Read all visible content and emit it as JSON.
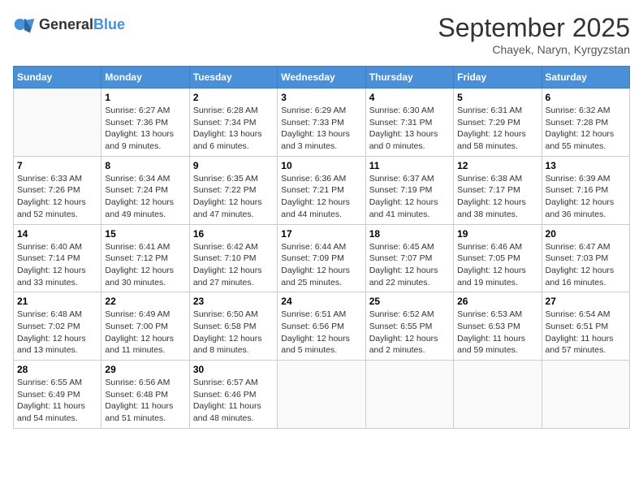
{
  "header": {
    "logo_general": "General",
    "logo_blue": "Blue",
    "month_title": "September 2025",
    "location": "Chayek, Naryn, Kyrgyzstan"
  },
  "days_of_week": [
    "Sunday",
    "Monday",
    "Tuesday",
    "Wednesday",
    "Thursday",
    "Friday",
    "Saturday"
  ],
  "weeks": [
    [
      {
        "day": "",
        "info": ""
      },
      {
        "day": "1",
        "info": "Sunrise: 6:27 AM\nSunset: 7:36 PM\nDaylight: 13 hours\nand 9 minutes."
      },
      {
        "day": "2",
        "info": "Sunrise: 6:28 AM\nSunset: 7:34 PM\nDaylight: 13 hours\nand 6 minutes."
      },
      {
        "day": "3",
        "info": "Sunrise: 6:29 AM\nSunset: 7:33 PM\nDaylight: 13 hours\nand 3 minutes."
      },
      {
        "day": "4",
        "info": "Sunrise: 6:30 AM\nSunset: 7:31 PM\nDaylight: 13 hours\nand 0 minutes."
      },
      {
        "day": "5",
        "info": "Sunrise: 6:31 AM\nSunset: 7:29 PM\nDaylight: 12 hours\nand 58 minutes."
      },
      {
        "day": "6",
        "info": "Sunrise: 6:32 AM\nSunset: 7:28 PM\nDaylight: 12 hours\nand 55 minutes."
      }
    ],
    [
      {
        "day": "7",
        "info": "Sunrise: 6:33 AM\nSunset: 7:26 PM\nDaylight: 12 hours\nand 52 minutes."
      },
      {
        "day": "8",
        "info": "Sunrise: 6:34 AM\nSunset: 7:24 PM\nDaylight: 12 hours\nand 49 minutes."
      },
      {
        "day": "9",
        "info": "Sunrise: 6:35 AM\nSunset: 7:22 PM\nDaylight: 12 hours\nand 47 minutes."
      },
      {
        "day": "10",
        "info": "Sunrise: 6:36 AM\nSunset: 7:21 PM\nDaylight: 12 hours\nand 44 minutes."
      },
      {
        "day": "11",
        "info": "Sunrise: 6:37 AM\nSunset: 7:19 PM\nDaylight: 12 hours\nand 41 minutes."
      },
      {
        "day": "12",
        "info": "Sunrise: 6:38 AM\nSunset: 7:17 PM\nDaylight: 12 hours\nand 38 minutes."
      },
      {
        "day": "13",
        "info": "Sunrise: 6:39 AM\nSunset: 7:16 PM\nDaylight: 12 hours\nand 36 minutes."
      }
    ],
    [
      {
        "day": "14",
        "info": "Sunrise: 6:40 AM\nSunset: 7:14 PM\nDaylight: 12 hours\nand 33 minutes."
      },
      {
        "day": "15",
        "info": "Sunrise: 6:41 AM\nSunset: 7:12 PM\nDaylight: 12 hours\nand 30 minutes."
      },
      {
        "day": "16",
        "info": "Sunrise: 6:42 AM\nSunset: 7:10 PM\nDaylight: 12 hours\nand 27 minutes."
      },
      {
        "day": "17",
        "info": "Sunrise: 6:44 AM\nSunset: 7:09 PM\nDaylight: 12 hours\nand 25 minutes."
      },
      {
        "day": "18",
        "info": "Sunrise: 6:45 AM\nSunset: 7:07 PM\nDaylight: 12 hours\nand 22 minutes."
      },
      {
        "day": "19",
        "info": "Sunrise: 6:46 AM\nSunset: 7:05 PM\nDaylight: 12 hours\nand 19 minutes."
      },
      {
        "day": "20",
        "info": "Sunrise: 6:47 AM\nSunset: 7:03 PM\nDaylight: 12 hours\nand 16 minutes."
      }
    ],
    [
      {
        "day": "21",
        "info": "Sunrise: 6:48 AM\nSunset: 7:02 PM\nDaylight: 12 hours\nand 13 minutes."
      },
      {
        "day": "22",
        "info": "Sunrise: 6:49 AM\nSunset: 7:00 PM\nDaylight: 12 hours\nand 11 minutes."
      },
      {
        "day": "23",
        "info": "Sunrise: 6:50 AM\nSunset: 6:58 PM\nDaylight: 12 hours\nand 8 minutes."
      },
      {
        "day": "24",
        "info": "Sunrise: 6:51 AM\nSunset: 6:56 PM\nDaylight: 12 hours\nand 5 minutes."
      },
      {
        "day": "25",
        "info": "Sunrise: 6:52 AM\nSunset: 6:55 PM\nDaylight: 12 hours\nand 2 minutes."
      },
      {
        "day": "26",
        "info": "Sunrise: 6:53 AM\nSunset: 6:53 PM\nDaylight: 11 hours\nand 59 minutes."
      },
      {
        "day": "27",
        "info": "Sunrise: 6:54 AM\nSunset: 6:51 PM\nDaylight: 11 hours\nand 57 minutes."
      }
    ],
    [
      {
        "day": "28",
        "info": "Sunrise: 6:55 AM\nSunset: 6:49 PM\nDaylight: 11 hours\nand 54 minutes."
      },
      {
        "day": "29",
        "info": "Sunrise: 6:56 AM\nSunset: 6:48 PM\nDaylight: 11 hours\nand 51 minutes."
      },
      {
        "day": "30",
        "info": "Sunrise: 6:57 AM\nSunset: 6:46 PM\nDaylight: 11 hours\nand 48 minutes."
      },
      {
        "day": "",
        "info": ""
      },
      {
        "day": "",
        "info": ""
      },
      {
        "day": "",
        "info": ""
      },
      {
        "day": "",
        "info": ""
      }
    ]
  ]
}
